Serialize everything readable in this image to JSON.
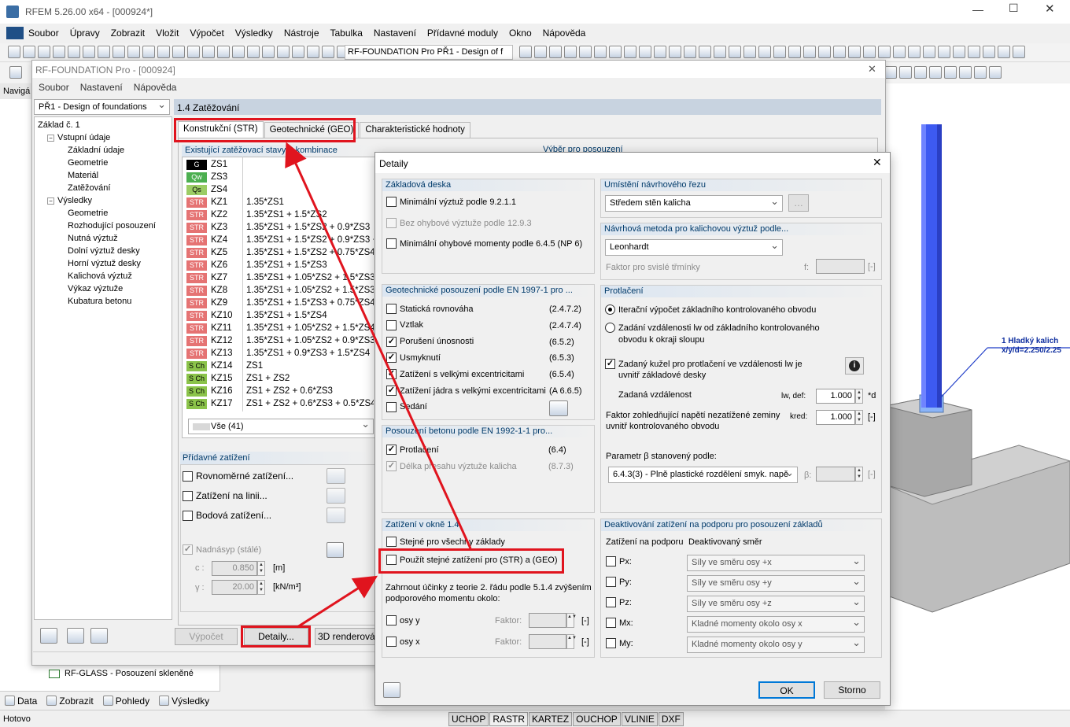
{
  "main_window": {
    "title": "RFEM 5.26.00 x64 - [000924*]",
    "menu": [
      "Soubor",
      "Úpravy",
      "Zobrazit",
      "Vložit",
      "Výpočet",
      "Výsledky",
      "Nástroje",
      "Tabulka",
      "Nastavení",
      "Přídavné moduly",
      "Okno",
      "Nápověda"
    ],
    "toolbar_combo": "RF-FOUNDATION Pro PŘ1 - Design of f",
    "nav_label": "Navigá",
    "bottom_tabs": [
      "Data",
      "Zobrazit",
      "Pohledy",
      "Výsledky"
    ],
    "nav_item_partial": "RF-GLASS - Posouzení skleněné",
    "status_left": "Hotovo",
    "status_buttons": [
      "UCHOP",
      "RASTR",
      "KARTEZ",
      "OUCHOP",
      "VLINIE",
      "DXF"
    ],
    "callout_line1": "1 Hladký kalich",
    "callout_line2": "x/y/d=2.250/2.25"
  },
  "module": {
    "title": "RF-FOUNDATION Pro - [000924]",
    "menu": [
      "Soubor",
      "Nastavení",
      "Nápověda"
    ],
    "case_combo": "PŘ1 - Design of foundations",
    "section_title": "1.4 Zatěžování",
    "tabs": [
      "Konstrukční (STR)",
      "Geotechnické (GEO)",
      "Charakteristické hodnoty"
    ],
    "tree": [
      {
        "label": "Základ č. 1",
        "level": 0
      },
      {
        "label": "Vstupní údaje",
        "level": 1
      },
      {
        "label": "Základní údaje",
        "level": 2
      },
      {
        "label": "Geometrie",
        "level": 2
      },
      {
        "label": "Materiál",
        "level": 2
      },
      {
        "label": "Zatěžování",
        "level": 2
      },
      {
        "label": "Výsledky",
        "level": 1
      },
      {
        "label": "Geometrie",
        "level": 2
      },
      {
        "label": "Rozhodující posouzení",
        "level": 2
      },
      {
        "label": "Nutná výztuž",
        "level": 2
      },
      {
        "label": "Dolní výztuž desky",
        "level": 2
      },
      {
        "label": "Horní výztuž desky",
        "level": 2
      },
      {
        "label": "Kalichová výztuž",
        "level": 2
      },
      {
        "label": "Výkaz výztuže",
        "level": 2
      },
      {
        "label": "Kubatura betonu",
        "level": 2
      }
    ],
    "existing_header": "Existující zatěžovací stavy a kombinace",
    "selection_header": "Výběr pro posouzení",
    "load_cases": [
      {
        "tag": "G",
        "type": "g",
        "id": "ZS1",
        "desc": ""
      },
      {
        "tag": "Qw",
        "type": "qw",
        "id": "ZS3",
        "desc": ""
      },
      {
        "tag": "Qs",
        "type": "qs",
        "id": "ZS4",
        "desc": ""
      },
      {
        "tag": "STR",
        "type": "str",
        "id": "KZ1",
        "desc": "1.35*ZS1"
      },
      {
        "tag": "STR",
        "type": "str",
        "id": "KZ2",
        "desc": "1.35*ZS1 + 1.5*ZS2"
      },
      {
        "tag": "STR",
        "type": "str",
        "id": "KZ3",
        "desc": "1.35*ZS1 + 1.5*ZS2 + 0.9*ZS3"
      },
      {
        "tag": "STR",
        "type": "str",
        "id": "KZ4",
        "desc": "1.35*ZS1 + 1.5*ZS2 + 0.9*ZS3 + 0"
      },
      {
        "tag": "STR",
        "type": "str",
        "id": "KZ5",
        "desc": "1.35*ZS1 + 1.5*ZS2 + 0.75*ZS4"
      },
      {
        "tag": "STR",
        "type": "str",
        "id": "KZ6",
        "desc": "1.35*ZS1 + 1.5*ZS3"
      },
      {
        "tag": "STR",
        "type": "str",
        "id": "KZ7",
        "desc": "1.35*ZS1 + 1.05*ZS2 + 1.5*ZS3"
      },
      {
        "tag": "STR",
        "type": "str",
        "id": "KZ8",
        "desc": "1.35*ZS1 + 1.05*ZS2 + 1.5*ZS3 +"
      },
      {
        "tag": "STR",
        "type": "str",
        "id": "KZ9",
        "desc": "1.35*ZS1 + 1.5*ZS3 + 0.75*ZS4"
      },
      {
        "tag": "STR",
        "type": "str",
        "id": "KZ10",
        "desc": "1.35*ZS1 + 1.5*ZS4"
      },
      {
        "tag": "STR",
        "type": "str",
        "id": "KZ11",
        "desc": "1.35*ZS1 + 1.05*ZS2 + 1.5*ZS4"
      },
      {
        "tag": "STR",
        "type": "str",
        "id": "KZ12",
        "desc": "1.35*ZS1 + 1.05*ZS2 + 0.9*ZS3 +"
      },
      {
        "tag": "STR",
        "type": "str",
        "id": "KZ13",
        "desc": "1.35*ZS1 + 0.9*ZS3 + 1.5*ZS4"
      },
      {
        "tag": "S Ch",
        "type": "sch",
        "id": "KZ14",
        "desc": "ZS1"
      },
      {
        "tag": "S Ch",
        "type": "sch",
        "id": "KZ15",
        "desc": "ZS1 + ZS2"
      },
      {
        "tag": "S Ch",
        "type": "sch",
        "id": "KZ16",
        "desc": "ZS1 + ZS2 + 0.6*ZS3"
      },
      {
        "tag": "S Ch",
        "type": "sch",
        "id": "KZ17",
        "desc": "ZS1 + ZS2 + 0.6*ZS3 + 0.5*ZS4"
      }
    ],
    "all_combo": "Vše (41)",
    "additional_header": "Přídavné zatížení",
    "additional_items": [
      "Rovnoměrné zatížení...",
      "Zatížení na linii...",
      "Bodová zatížení..."
    ],
    "backfill_label": "Nadnásyp (stálé)",
    "c_label": "c :",
    "c_value": "0.850",
    "c_unit": "[m]",
    "gamma_label": "γ :",
    "gamma_value": "20.00",
    "gamma_unit": "[kN/m³]",
    "btn_calc": "Výpočet",
    "btn_details": "Detaily...",
    "btn_3d": "3D renderování"
  },
  "details": {
    "title": "Detaily",
    "slab_header": "Základová deska",
    "slab_items": [
      {
        "label": "Minimální výztuž podle 9.2.1.1",
        "checked": false,
        "disabled": false
      },
      {
        "label": "Bez ohybové výztuže podle 12.9.3",
        "checked": false,
        "disabled": true
      },
      {
        "label": "Minimální ohybové momenty podle 6.4.5 (NP 6)",
        "checked": false,
        "disabled": false
      }
    ],
    "geo_header": "Geotechnické posouzení podle EN 1997-1 pro ...",
    "geo_items": [
      {
        "label": "Statická rovnováha",
        "ref": "(2.4.7.2)",
        "checked": false
      },
      {
        "label": "Vztlak",
        "ref": "(2.4.7.4)",
        "checked": false
      },
      {
        "label": "Porušení únosnosti",
        "ref": "(6.5.2)",
        "checked": true
      },
      {
        "label": "Usmyknutí",
        "ref": "(6.5.3)",
        "checked": true
      },
      {
        "label": "Zatížení s velkými excentricitami",
        "ref": "(6.5.4)",
        "checked": true
      },
      {
        "label": "Zatížení jádra s velkými excentricitami",
        "ref": "(A 6.6.5)",
        "checked": true
      },
      {
        "label": "Sedání",
        "ref": "",
        "checked": false
      }
    ],
    "concrete_header": "Posouzení betonu podle EN 1992-1-1 pro...",
    "concrete_items": [
      {
        "label": "Protlačení",
        "ref": "(6.4)",
        "checked": true,
        "disabled": false
      },
      {
        "label": "Délka přesahu výztuže kalicha",
        "ref": "(8.7.3)",
        "checked": true,
        "disabled": true
      }
    ],
    "loads_header": "Zatížení v okně 1.4",
    "loads_items": [
      "Stejné pro všechny základy",
      "Použít stejné zatížení pro (STR) a (GEO)"
    ],
    "second_order_text": "Zahrnout účinky z teorie 2. řádu podle 5.1.4 zvýšením podporového momentu okolo:",
    "axis_items": [
      "osy y",
      "osy x"
    ],
    "factor_label": "Faktor:",
    "factor_unit": "[-]",
    "section_header": "Umístění návrhového řezu",
    "section_value": "Středem stěn kalicha",
    "method_header": "Návrhová metoda pro kalichovou výztuž podle...",
    "method_value": "Leonhardt",
    "stirrups_label": "Faktor pro svislé třmínky",
    "stirrups_sym": "f:",
    "stirrups_unit": "[-]",
    "punching_header": "Protlačení",
    "punch_radio1": "Iterační výpočet základního kontrolovaného obvodu",
    "punch_radio2a": "Zadání vzdálenosti lw od základního kontrolovaného",
    "punch_radio2b": "obvodu k okraji sloupu",
    "cone_a": "Zadaný kužel pro protlačení ve vzdálenosti lw je",
    "cone_b": "uvnitř základové desky",
    "dist_label": "Zadaná vzdálenost",
    "dist_sym": "lw, def:",
    "dist_value": "1.000",
    "dist_unit": "*d",
    "kred_a": "Faktor zohledňující napětí nezatížené zeminy",
    "kred_b": "uvnitř kontrolovaného obvodu",
    "kred_sym": "kred:",
    "kred_value": "1.000",
    "kred_unit": "[-]",
    "beta_label": "Parametr β stanovený podle:",
    "beta_value": "6.4.3(3) - Plně plastické rozdělení smyk. napě",
    "beta_sym": "β:",
    "beta_unit": "[-]",
    "deact_header": "Deaktivování zatížení na podporu pro posouzení základů",
    "deact_col1": "Zatížení na podporu",
    "deact_col2": "Deaktivovaný směr",
    "deact_rows": [
      {
        "label": "Px:",
        "value": "Síly ve směru osy +x"
      },
      {
        "label": "Py:",
        "value": "Síly ve směru osy +y"
      },
      {
        "label": "Pz:",
        "value": "Síly ve směru osy +z"
      },
      {
        "label": "Mx:",
        "value": "Kladné momenty okolo osy x"
      },
      {
        "label": "My:",
        "value": "Kladné momenty okolo osy y"
      }
    ],
    "ok": "OK",
    "cancel": "Storno"
  }
}
